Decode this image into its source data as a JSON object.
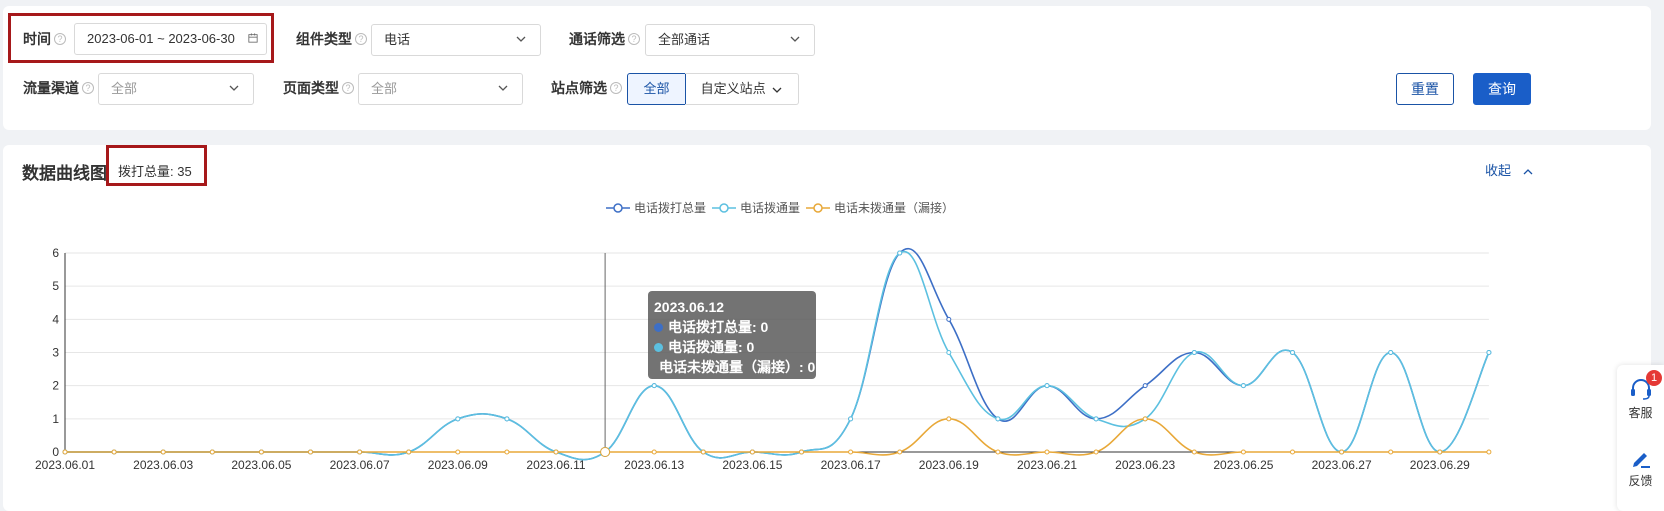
{
  "filters": {
    "time": {
      "label": "时间",
      "value": "2023-06-01 ~ 2023-06-30"
    },
    "component_type": {
      "label": "组件类型",
      "value": "电话"
    },
    "call_filter": {
      "label": "通话筛选",
      "value": "全部通话"
    },
    "traffic_channel": {
      "label": "流量渠道",
      "placeholder": "全部"
    },
    "page_type": {
      "label": "页面类型",
      "placeholder": "全部"
    },
    "site_filter": {
      "label": "站点筛选",
      "option_all": "全部",
      "option_custom": "自定义站点"
    },
    "reset_label": "重置",
    "query_label": "查询"
  },
  "chart_section": {
    "title": "数据曲线图",
    "total_label": "拨打总量: 35",
    "collapse_label": "收起"
  },
  "chart_data": {
    "type": "line",
    "x": [
      "2023.06.01",
      "2023.06.02",
      "2023.06.03",
      "2023.06.04",
      "2023.06.05",
      "2023.06.06",
      "2023.06.07",
      "2023.06.08",
      "2023.06.09",
      "2023.06.10",
      "2023.06.11",
      "2023.06.12",
      "2023.06.13",
      "2023.06.14",
      "2023.06.15",
      "2023.06.16",
      "2023.06.17",
      "2023.06.18",
      "2023.06.19",
      "2023.06.20",
      "2023.06.21",
      "2023.06.22",
      "2023.06.23",
      "2023.06.24",
      "2023.06.25",
      "2023.06.26",
      "2023.06.27",
      "2023.06.28",
      "2023.06.29",
      "2023.06.30"
    ],
    "x_tick_labels": [
      "2023.06.01",
      "2023.06.03",
      "2023.06.05",
      "2023.06.07",
      "2023.06.09",
      "2023.06.11",
      "2023.06.13",
      "2023.06.15",
      "2023.06.17",
      "2023.06.19",
      "2023.06.21",
      "2023.06.23",
      "2023.06.25",
      "2023.06.27",
      "2023.06.29"
    ],
    "y_ticks": [
      0,
      1,
      2,
      3,
      4,
      5,
      6
    ],
    "ylim": [
      0,
      6
    ],
    "grid": true,
    "legend_position": "top-center",
    "series": [
      {
        "name": "电话拨打总量",
        "color": "#3d6fc6",
        "values": [
          0,
          0,
          0,
          0,
          0,
          0,
          0,
          0,
          1,
          1,
          0,
          0,
          2,
          0,
          0,
          0,
          1,
          6,
          4,
          1,
          2,
          1,
          2,
          3,
          2,
          3,
          0,
          3,
          0,
          3
        ]
      },
      {
        "name": "电话拨通量",
        "color": "#5cc0e0",
        "values": [
          0,
          0,
          0,
          0,
          0,
          0,
          0,
          0,
          1,
          1,
          0,
          0,
          2,
          0,
          0,
          0,
          1,
          6,
          3,
          1,
          2,
          1,
          1,
          3,
          2,
          3,
          0,
          3,
          0,
          3
        ]
      },
      {
        "name": "电话未拨通量（漏接）",
        "color": "#e8a838",
        "values": [
          0,
          0,
          0,
          0,
          0,
          0,
          0,
          0,
          0,
          0,
          0,
          0,
          0,
          0,
          0,
          0,
          0,
          0,
          1,
          0,
          0,
          0,
          1,
          0,
          0,
          0,
          0,
          0,
          0,
          0
        ]
      }
    ],
    "tooltip": {
      "date": "2023.06.12",
      "rows": [
        {
          "text": "电话拨打总量: 0",
          "color": "#3d6fc6"
        },
        {
          "text": "电话拨通量: 0",
          "color": "#5cc0e0"
        },
        {
          "text": "电话未拨通量（漏接）: 0",
          "color": "#e8a838"
        }
      ]
    }
  },
  "side_widget": {
    "support_label": "客服",
    "support_badge": "1",
    "feedback_label": "反馈"
  }
}
